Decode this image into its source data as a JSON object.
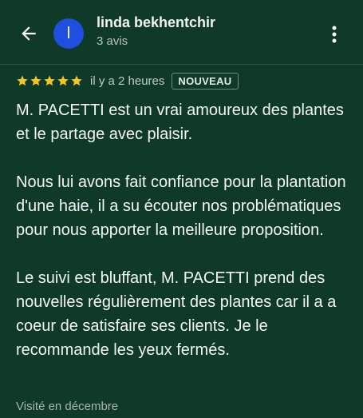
{
  "header": {
    "reviewer_name": "linda bekhentchir",
    "avatar_initial": "l",
    "review_count": "3 avis",
    "avatar_color": "#1f4fe0"
  },
  "review": {
    "rating": 5,
    "max_rating": 5,
    "time_ago": "il y a 2 heures",
    "badge": "NOUVEAU",
    "paragraphs": [
      "M. PACETTI est un vrai amoureux des plantes et le partage avec plaisir.",
      "Nous lui avons fait confiance pour la plantation d'une haie, il a su écouter nos problématiques pour nous apporter la meilleure proposition.",
      "Le suivi est bluffant, M. PACETTI prend des nouvelles régulièrement des plantes car il a a coeur de satisfaire ses clients. Je le recommande les yeux fermés."
    ],
    "visited": "Visité en décembre"
  },
  "icons": {
    "back": "arrow-left-icon",
    "more": "more-vert-icon",
    "star": "star-icon"
  },
  "colors": {
    "background": "#0f3a28",
    "star": "#f5c518"
  }
}
